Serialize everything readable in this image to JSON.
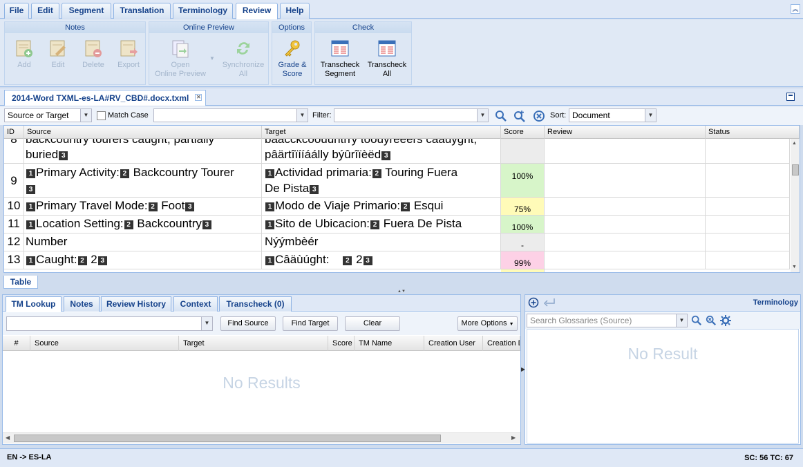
{
  "menu": {
    "tabs": [
      "File",
      "Edit",
      "Segment",
      "Translation",
      "Terminology",
      "Review",
      "Help"
    ],
    "active": "Review"
  },
  "ribbon": {
    "notes": {
      "title": "Notes",
      "add": "Add",
      "edit": "Edit",
      "delete": "Delete",
      "export": "Export"
    },
    "online_preview": {
      "title": "Online Preview",
      "open_l1": "Open",
      "open_l2": "Online Preview",
      "sync_l1": "Synchronize",
      "sync_l2": "All"
    },
    "options": {
      "title": "Options",
      "grade_l1": "Grade &",
      "grade_l2": "Score"
    },
    "check": {
      "title": "Check",
      "seg_l1": "Transcheck",
      "seg_l2": "Segment",
      "all_l1": "Transcheck",
      "all_l2": "All"
    }
  },
  "document": {
    "tab_title": "2014-Word TXML-es-LA#RV_CBD#.docx.txml"
  },
  "filter": {
    "scope": "Source or Target",
    "match_case": "Match Case",
    "filter_label": "Filter:",
    "sort_label": "Sort:",
    "sort_value": "Document"
  },
  "grid": {
    "columns": {
      "id": "ID",
      "source": "Source",
      "target": "Target",
      "score": "Score",
      "review": "Review",
      "status": "Status"
    },
    "partial_row": {
      "id": "8",
      "src_top": "backcountry tourers caught, partially",
      "src_bottom": "buried",
      "tgt_top": "bâäcckcöôüüntrry tööüyrêeêrs câäüyght,",
      "tgt_bottom": "pâärtîïííáálly býûrîïèëd"
    },
    "rows": [
      {
        "id": "9",
        "score": "100%",
        "score_color": "#d7f5c9",
        "tgt_1": "Actividad primaria:",
        "tgt_2": "Touring Fuera",
        "tgt_3": "De Pista",
        "src_1": "Primary Activity:",
        "src_2": "Backcountry Tourer"
      },
      {
        "id": "10",
        "score": "75%",
        "score_color": "#fffbb8",
        "src_1": "Primary Travel Mode:",
        "src_2": "Foot",
        "tgt_1": "Modo de Viaje Primario:",
        "tgt_2": "Esqui"
      },
      {
        "id": "11",
        "score": "100%",
        "score_color": "#d7f5c9",
        "src_1": "Location Setting:",
        "src_2": "Backcountry",
        "tgt_1": "Sito de Ubicacion:",
        "tgt_2": "Fuera De Pista"
      },
      {
        "id": "12",
        "score": "-",
        "score_color": "#ececec",
        "src_1": "Number",
        "tgt_1": "Nýýmbèér"
      },
      {
        "id": "13",
        "score": "99%",
        "score_color": "#fdd1e6",
        "src_1": "Caught:",
        "src_2": "2",
        "tgt_1": "Câäùúght:",
        "tgt_2": "2"
      }
    ]
  },
  "table_tab": "Table",
  "tm": {
    "tabs": [
      "TM Lookup",
      "Notes",
      "Review History",
      "Context",
      "Transcheck (0)"
    ],
    "find_source": "Find Source",
    "find_target": "Find Target",
    "clear": "Clear",
    "more_options": "More Options",
    "columns": [
      "#",
      "Source",
      "Target",
      "Score",
      "TM Name",
      "Creation User",
      "Creation D"
    ],
    "no_results": "No Results"
  },
  "terminology": {
    "title": "Terminology",
    "search_placeholder": "Search Glossaries (Source)",
    "no_result": "No Result"
  },
  "status": {
    "lang": "EN -> ES-LA",
    "counts": "SC: 56 TC: 67"
  }
}
